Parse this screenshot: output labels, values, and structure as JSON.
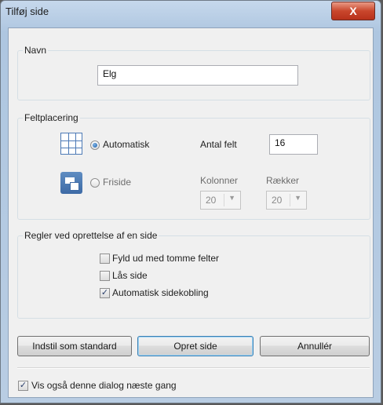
{
  "window": {
    "title": "Tilføj side",
    "close_glyph": "X"
  },
  "name_group": {
    "label": "Navn",
    "value": "Elg"
  },
  "placement_group": {
    "label": "Feltplacering",
    "automatic_label": "Automatisk",
    "automatic_checked": true,
    "free_label": "Friside",
    "free_checked": false,
    "field_count_label": "Antal felt",
    "field_count_value": "16",
    "columns_label": "Kolonner",
    "columns_value": "20",
    "rows_label": "Rækker",
    "rows_value": "20",
    "automatic_icon": "grid-icon",
    "free_icon": "free-layout-icon"
  },
  "rules_group": {
    "label": "Regler ved oprettelse af en side",
    "items": [
      {
        "label": "Fyld ud med tomme felter",
        "checked": false
      },
      {
        "label": "Lås side",
        "checked": false
      },
      {
        "label": "Automatisk sidekobling",
        "checked": true
      }
    ]
  },
  "buttons": {
    "set_default": "Indstil som standard",
    "create": "Opret side",
    "cancel": "Annullér"
  },
  "footer": {
    "show_again_label": "Vis også denne dialog næste gang",
    "show_again_checked": true
  },
  "check_glyph": "✓",
  "dropdown_glyph": "▼"
}
